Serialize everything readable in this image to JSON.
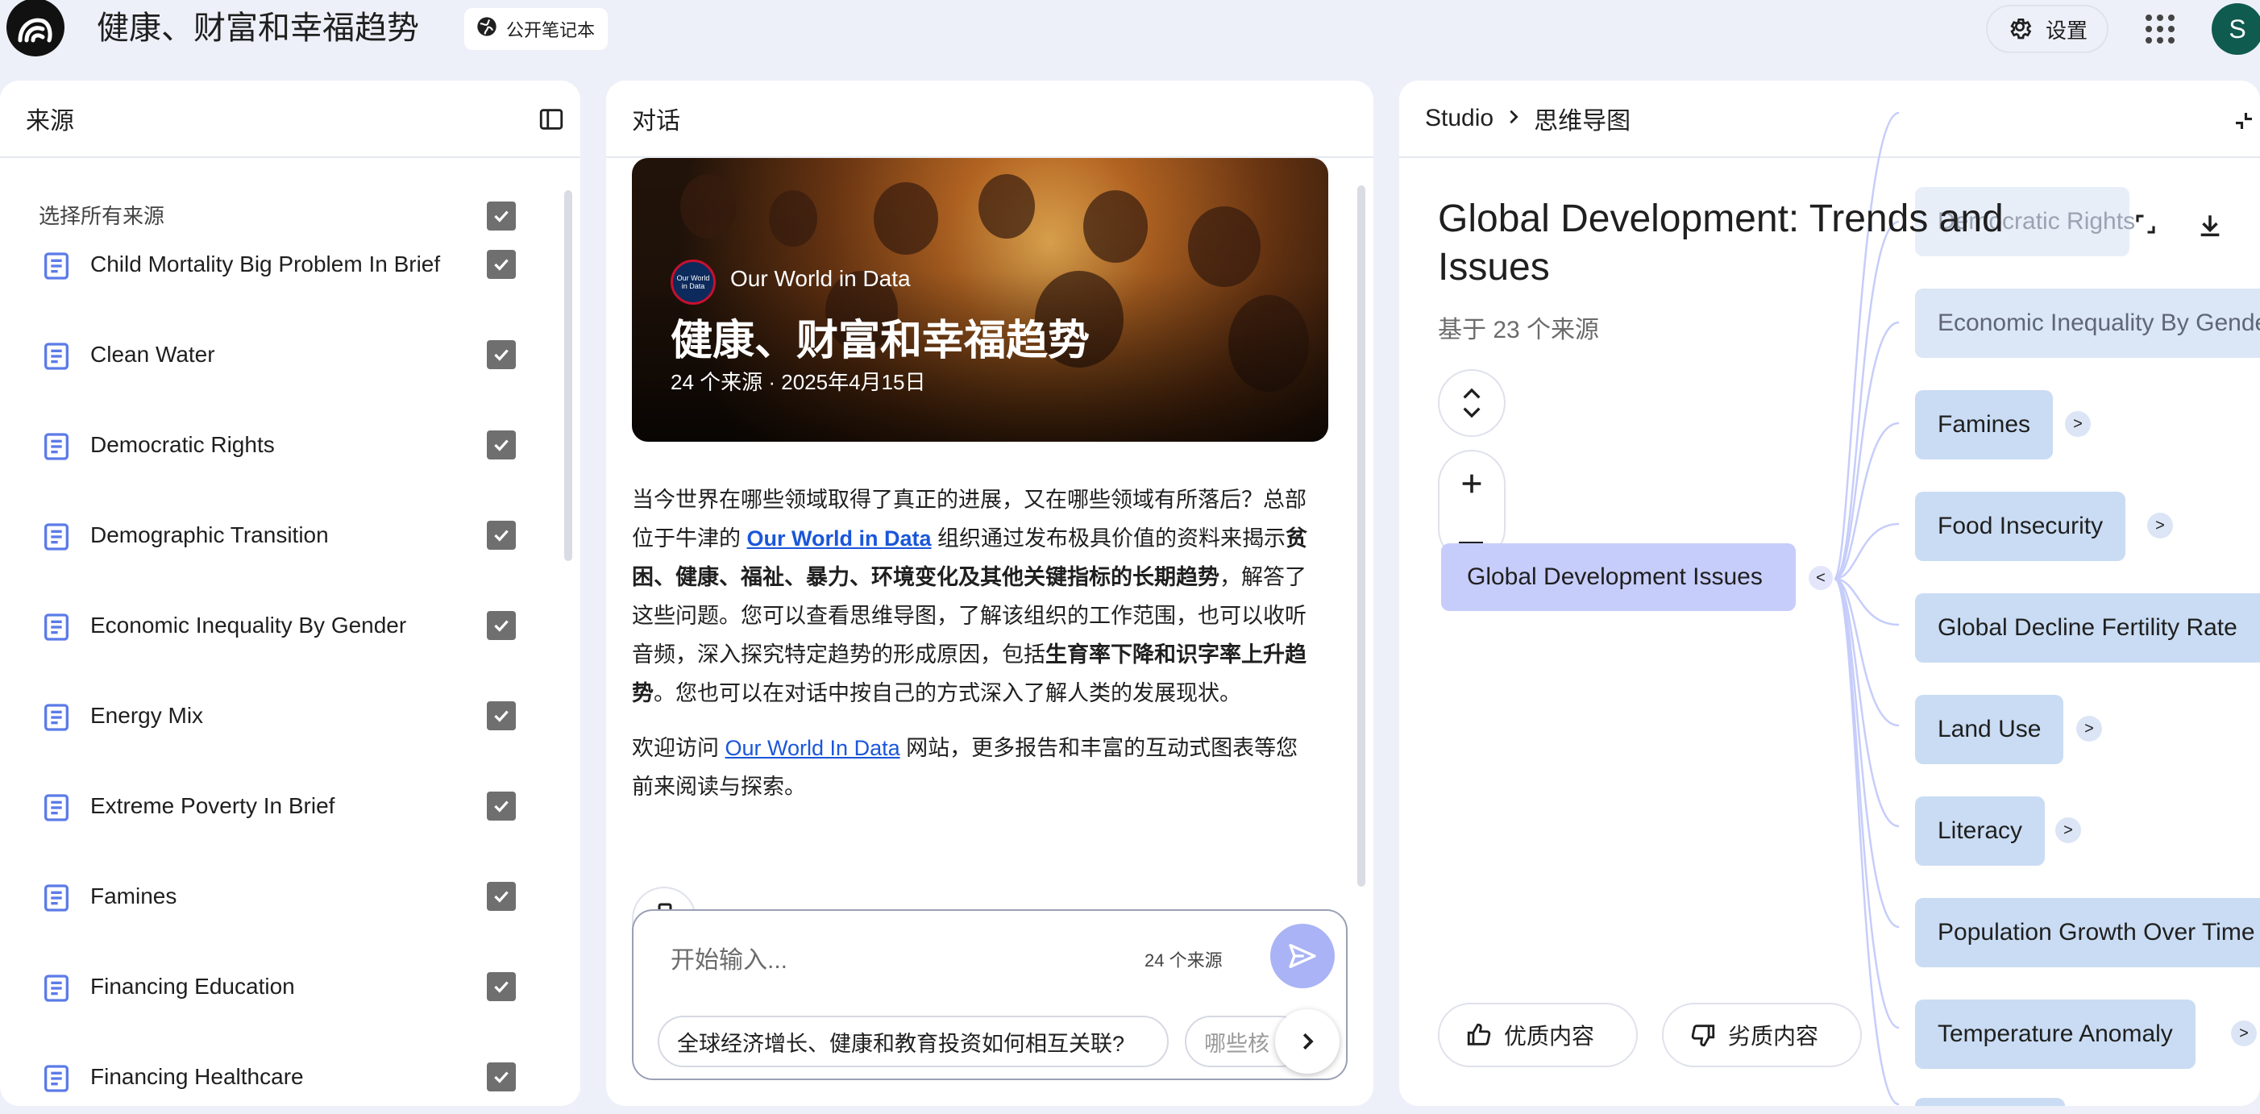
{
  "app": {
    "title": "健康、财富和幸福趋势",
    "public_chip": "公开笔记本",
    "settings_label": "设置",
    "avatar_initial": "S"
  },
  "sources": {
    "header": "来源",
    "select_all_label": "选择所有来源",
    "items": [
      {
        "label": "Child Mortality Big Problem In Brief",
        "checked": true
      },
      {
        "label": "Clean Water",
        "checked": true
      },
      {
        "label": "Democratic Rights",
        "checked": true
      },
      {
        "label": "Demographic Transition",
        "checked": true
      },
      {
        "label": "Economic Inequality By Gender",
        "checked": true
      },
      {
        "label": "Energy Mix",
        "checked": true
      },
      {
        "label": "Extreme Poverty In Brief",
        "checked": true
      },
      {
        "label": "Famines",
        "checked": true
      },
      {
        "label": "Financing Education",
        "checked": true
      },
      {
        "label": "Financing Healthcare",
        "checked": true
      }
    ]
  },
  "chat": {
    "header": "对话",
    "hero": {
      "publisher": "Our World in Data",
      "badge_text": "Our World in Data",
      "title": "健康、财富和幸福趋势",
      "meta": "24 个来源 · 2025年4月15日"
    },
    "intro": {
      "p1_a": "当今世界在哪些领域取得了真正的进展，又在哪些领域有所落后？总部位于牛津的 ",
      "p1_link": "Our World in Data",
      "p1_b": " 组织通过发布极具价值的资料来揭示",
      "p1_bold1": "贫困、健康、福祉、暴力、环境变化及其他关键指标的长期趋势",
      "p1_c": "，解答了这些问题。您可以查看思维导图，了解该组织的工作范围，也可以收听音频，深入探究特定趋势的形成原因，包括",
      "p1_bold2": "生育率下降和识字率上升趋势",
      "p1_d": "。您也可以在对话中按自己的方式深入了解人类的发展现状。",
      "p2_a": "欢迎访问 ",
      "p2_link": "Our World In Data",
      "p2_b": " 网站，更多报告和丰富的互动式图表等您前来阅读与探索。"
    },
    "composer": {
      "placeholder": "开始输入...",
      "source_count": "24 个来源"
    },
    "suggestions": [
      "全球经济增长、健康和教育投资如何相互关联?",
      "哪些核"
    ]
  },
  "studio": {
    "crumb_root": "Studio",
    "crumb_current": "思维导图",
    "title": "Global Development: Trends and Issues",
    "subtitle": "基于 23 个来源",
    "mindmap": {
      "root": "Global Development Issues",
      "collapse_glyph": "<",
      "expand_glyph": ">",
      "children": [
        "Democratic Rights",
        "Economic Inequality By Gender",
        "Famines",
        "Food Insecurity",
        "Global Decline Fertility Rate",
        "Land Use",
        "Literacy",
        "Population Growth Over Time",
        "Temperature Anomaly"
      ]
    },
    "feedback": {
      "good": "优质内容",
      "bad": "劣质内容"
    }
  },
  "colors": {
    "background": "#eef0f9",
    "accent": "#a9b3f5",
    "root_node": "#c7cdfb",
    "child_node": "#c9dcf3",
    "link": "#1a56d9",
    "avatar": "#0f5b4f"
  }
}
